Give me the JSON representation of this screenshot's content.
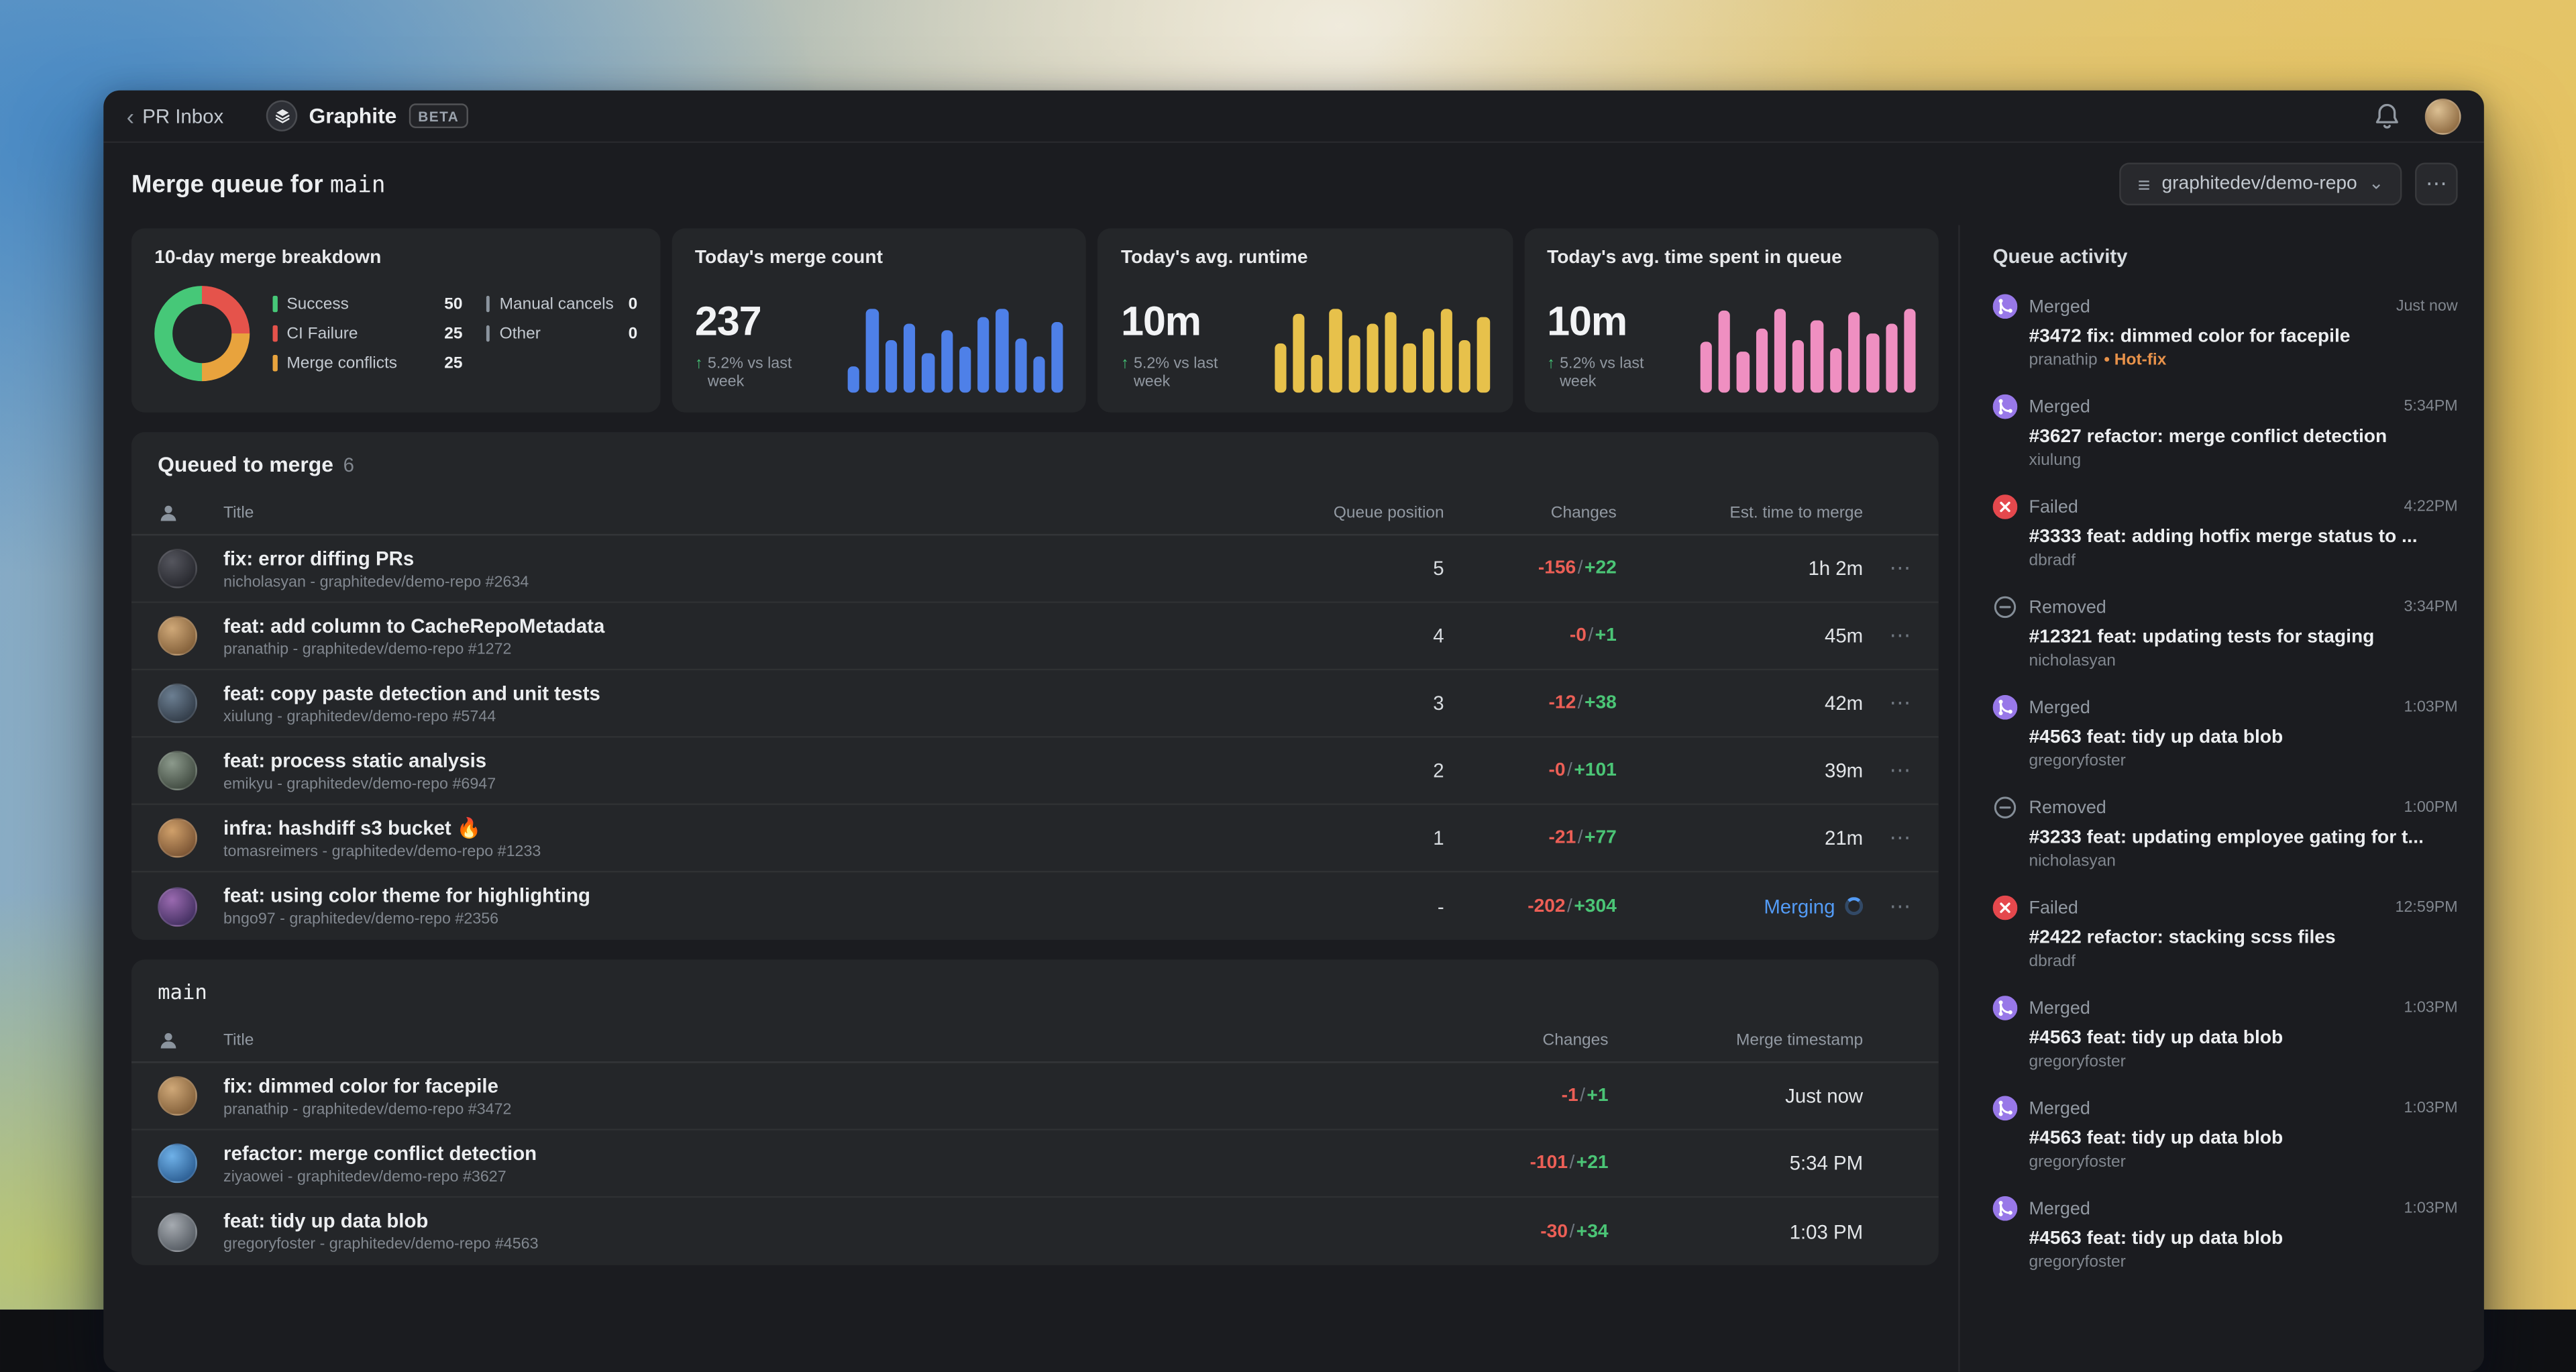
{
  "icons": {
    "back_chevron": "‹",
    "repo": "≡",
    "chevron_down": "⌄",
    "menu_dots": "⋯",
    "row_menu_dots": "⋯"
  },
  "topbar": {
    "back_label": "PR Inbox",
    "app_name": "Graphite",
    "beta_badge": "BETA"
  },
  "header": {
    "title_prefix": "Merge queue for",
    "branch": "main",
    "repo_selector_value": "graphitedev/demo-repo"
  },
  "chart_data": [
    {
      "type": "pie",
      "title": "10-day merge breakdown",
      "categories": [
        "Success",
        "CI Failure",
        "Merge conflicts",
        "Manual cancels",
        "Other"
      ],
      "values": [
        50,
        25,
        25,
        0,
        0
      ]
    },
    {
      "type": "bar",
      "title": "Today's merge count",
      "values": [
        30,
        95,
        60,
        78,
        45,
        70,
        52,
        85,
        95,
        62,
        40,
        80
      ]
    },
    {
      "type": "bar",
      "title": "Today's avg. runtime",
      "values": [
        55,
        88,
        42,
        95,
        65,
        78,
        90,
        55,
        72,
        95,
        60,
        85
      ]
    },
    {
      "type": "bar",
      "title": "Today's avg. time spent in queue",
      "values": [
        58,
        92,
        46,
        72,
        95,
        60,
        82,
        50,
        90,
        66,
        78,
        95
      ]
    }
  ],
  "stats": {
    "breakdown": {
      "title": "10-day merge breakdown",
      "segments": [
        {
          "label": "Success",
          "value": 50,
          "display": "50",
          "color": "#46c878"
        },
        {
          "label": "CI Failure",
          "value": 25,
          "display": "25",
          "color": "#e5534b"
        },
        {
          "label": "Merge conflicts",
          "value": 25,
          "display": "25",
          "color": "#e8a33d"
        },
        {
          "label": "Manual cancels",
          "value": 0,
          "display": "0",
          "color": "#8b949e"
        },
        {
          "label": "Other",
          "value": 0,
          "display": "0",
          "color": "#8b949e"
        }
      ]
    },
    "cards": [
      {
        "title": "Today's merge count",
        "value": "237",
        "delta_arrow": "↑",
        "delta_text": "5.2% vs last week",
        "bar_color": "#4e80e8",
        "bars": [
          30,
          95,
          60,
          78,
          45,
          70,
          52,
          85,
          95,
          62,
          40,
          80
        ]
      },
      {
        "title": "Today's avg. runtime",
        "value": "10m",
        "delta_arrow": "↑",
        "delta_text": "5.2% vs last week",
        "bar_color": "#e7c14b",
        "bars": [
          55,
          88,
          42,
          95,
          65,
          78,
          90,
          55,
          72,
          95,
          60,
          85
        ]
      },
      {
        "title": "Today's avg. time spent in queue",
        "value": "10m",
        "delta_arrow": "↑",
        "delta_text": "5.2% vs last week",
        "bar_color": "#ef8fc1",
        "bars": [
          58,
          92,
          46,
          72,
          95,
          60,
          82,
          50,
          90,
          66,
          78,
          95
        ]
      }
    ]
  },
  "queued_table": {
    "title": "Queued to merge",
    "count": "6",
    "columns": {
      "title": "Title",
      "queue_position": "Queue position",
      "changes": "Changes",
      "est_time": "Est. time to merge"
    },
    "rows": [
      {
        "title": "fix: error diffing PRs",
        "sub": "nicholasyan - graphitedev/demo-repo #2634",
        "pos": "5",
        "del": "-156",
        "add": "+22",
        "est": "1h 2m",
        "avatar": "radial-gradient(circle at 35% 30%, #55565e, #26272d 80%)"
      },
      {
        "title": "feat: add column to CacheRepoMetadata",
        "sub": "pranathip - graphitedev/demo-repo #1272",
        "pos": "4",
        "del": "-0",
        "add": "+1",
        "est": "45m",
        "avatar": "radial-gradient(circle at 35% 30%, #cfa878, #83603a 80%)"
      },
      {
        "title": "feat: copy paste detection and unit tests",
        "sub": "xiulung - graphitedev/demo-repo #5744",
        "pos": "3",
        "del": "-12",
        "add": "+38",
        "est": "42m",
        "avatar": "radial-gradient(circle at 35% 30%, #6c7f92, #323c48 80%)"
      },
      {
        "title": "feat: process static analysis",
        "sub": "emikyu - graphitedev/demo-repo #6947",
        "pos": "2",
        "del": "-0",
        "add": "+101",
        "est": "39m",
        "avatar": "radial-gradient(circle at 35% 30%, #8c9a8c, #414b41 80%)"
      },
      {
        "title": "infra: hashdiff s3 bucket 🔥",
        "sub": "tomasreimers - graphitedev/demo-repo #1233",
        "pos": "1",
        "del": "-21",
        "add": "+77",
        "est": "21m",
        "avatar": "radial-gradient(circle at 35% 30%, #d0a06a, #7a5434 80%)"
      },
      {
        "title": "feat: using color theme for highlighting",
        "sub": "bngo97 - graphitedev/demo-repo #2356",
        "pos": "-",
        "del": "-202",
        "add": "+304",
        "est": "Merging",
        "row_class": "merging",
        "avatar": "radial-gradient(circle at 35% 30%, #9a6ab0, #433061 80%)"
      }
    ]
  },
  "merged_table": {
    "title": "main",
    "columns": {
      "title": "Title",
      "changes": "Changes",
      "timestamp": "Merge timestamp"
    },
    "rows": [
      {
        "title": "fix: dimmed color for facepile",
        "sub": "pranathip - graphitedev/demo-repo #3472",
        "del": "-1",
        "add": "+1",
        "ts": "Just now",
        "avatar": "radial-gradient(circle at 35% 30%, #cfa878, #83603a 80%)"
      },
      {
        "title": "refactor: merge conflict detection",
        "sub": "ziyaowei - graphitedev/demo-repo #3627",
        "del": "-101",
        "add": "+21",
        "ts": "5:34 PM",
        "avatar": "radial-gradient(circle at 35% 30%, #6fb1e8, #2c5e93 80%)"
      },
      {
        "title": "feat: tidy up data blob",
        "sub": "gregoryfoster - graphitedev/demo-repo #4563",
        "del": "-30",
        "add": "+34",
        "ts": "1:03 PM",
        "avatar": "radial-gradient(circle at 35% 30%, #a6abb1, #565c63 80%)"
      }
    ]
  },
  "activity": {
    "title": "Queue activity",
    "items": [
      {
        "kind": "merged",
        "label": "Merged",
        "time": "Just now",
        "title": "#3472 fix: dimmed color for facepile",
        "author": "pranathip",
        "tag": "• Hot-fix"
      },
      {
        "kind": "merged",
        "label": "Merged",
        "time": "5:34PM",
        "title": "#3627 refactor: merge conflict detection",
        "author": "xiulung"
      },
      {
        "kind": "failed",
        "label": "Failed",
        "time": "4:22PM",
        "title": "#3333 feat: adding hotfix merge status to ...",
        "author": "dbradf"
      },
      {
        "kind": "removed",
        "label": "Removed",
        "time": "3:34PM",
        "title": "#12321 feat: updating tests for staging",
        "author": "nicholasyan"
      },
      {
        "kind": "merged",
        "label": "Merged",
        "time": "1:03PM",
        "title": "#4563 feat: tidy up data blob",
        "author": "gregoryfoster"
      },
      {
        "kind": "removed",
        "label": "Removed",
        "time": "1:00PM",
        "title": "#3233 feat: updating employee gating for t...",
        "author": "nicholasyan"
      },
      {
        "kind": "failed",
        "label": "Failed",
        "time": "12:59PM",
        "title": "#2422 refactor: stacking scss files",
        "author": "dbradf"
      },
      {
        "kind": "merged",
        "label": "Merged",
        "time": "1:03PM",
        "title": "#4563 feat: tidy up data blob",
        "author": "gregoryfoster"
      },
      {
        "kind": "merged",
        "label": "Merged",
        "time": "1:03PM",
        "title": "#4563 feat: tidy up data blob",
        "author": "gregoryfoster"
      },
      {
        "kind": "merged",
        "label": "Merged",
        "time": "1:03PM",
        "title": "#4563 feat: tidy up data blob",
        "author": "gregoryfoster"
      }
    ]
  }
}
